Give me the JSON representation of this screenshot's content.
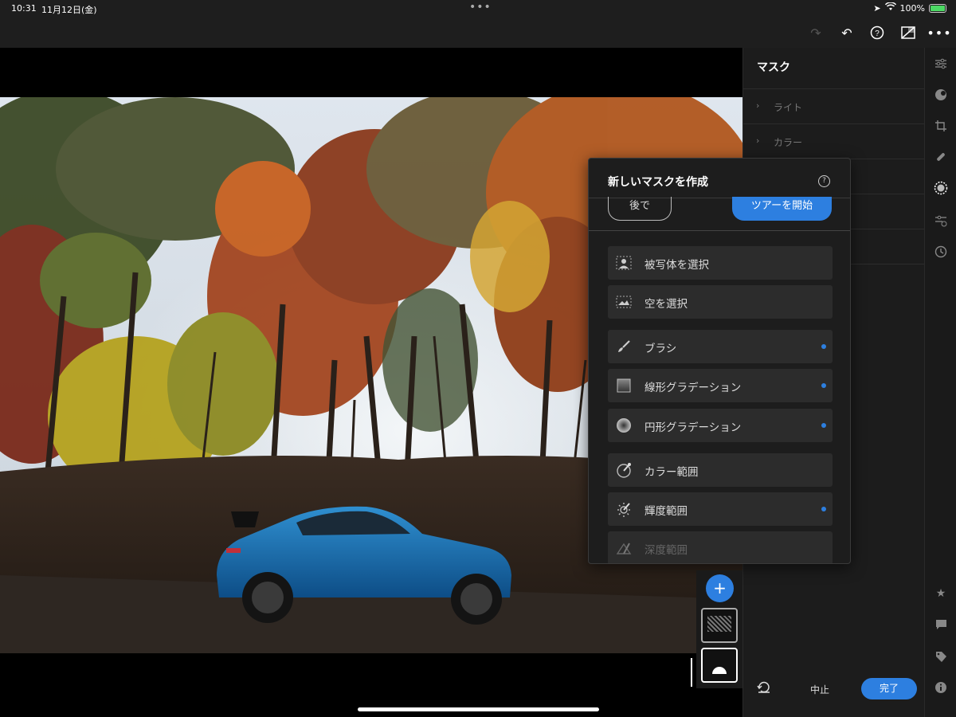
{
  "status_bar": {
    "time": "10:31",
    "date": "11月12日(金)",
    "battery": "100%",
    "more_dots": "•••"
  },
  "toolbar": {
    "redo_icon": "redo-icon",
    "undo_icon": "undo-icon",
    "help_icon": "help-icon",
    "compare_icon": "compare-icon",
    "more_icon": "more-icon"
  },
  "right_panel": {
    "title": "マスク",
    "sections": [
      {
        "label": "ライト"
      },
      {
        "label": "カラー"
      }
    ]
  },
  "popup": {
    "title": "新しいマスクを作成",
    "later_label": "後で",
    "tour_label": "ツアーを開始",
    "items": [
      {
        "label": "被写体を選択",
        "icon": "subject-icon",
        "dot": false
      },
      {
        "label": "空を選択",
        "icon": "sky-icon",
        "dot": false
      },
      {
        "label": "ブラシ",
        "icon": "brush-icon",
        "dot": true
      },
      {
        "label": "線形グラデーション",
        "icon": "linear-gradient-icon",
        "dot": true
      },
      {
        "label": "円形グラデーション",
        "icon": "radial-gradient-icon",
        "dot": true
      },
      {
        "label": "カラー範囲",
        "icon": "color-range-icon",
        "dot": false
      },
      {
        "label": "輝度範囲",
        "icon": "luminance-range-icon",
        "dot": true
      },
      {
        "label": "深度範囲",
        "icon": "depth-range-icon",
        "dot": false
      }
    ]
  },
  "bottom": {
    "cancel_label": "中止",
    "done_label": "完了"
  },
  "colors": {
    "accent": "#2d7fe0",
    "panel": "#1c1c1c"
  }
}
